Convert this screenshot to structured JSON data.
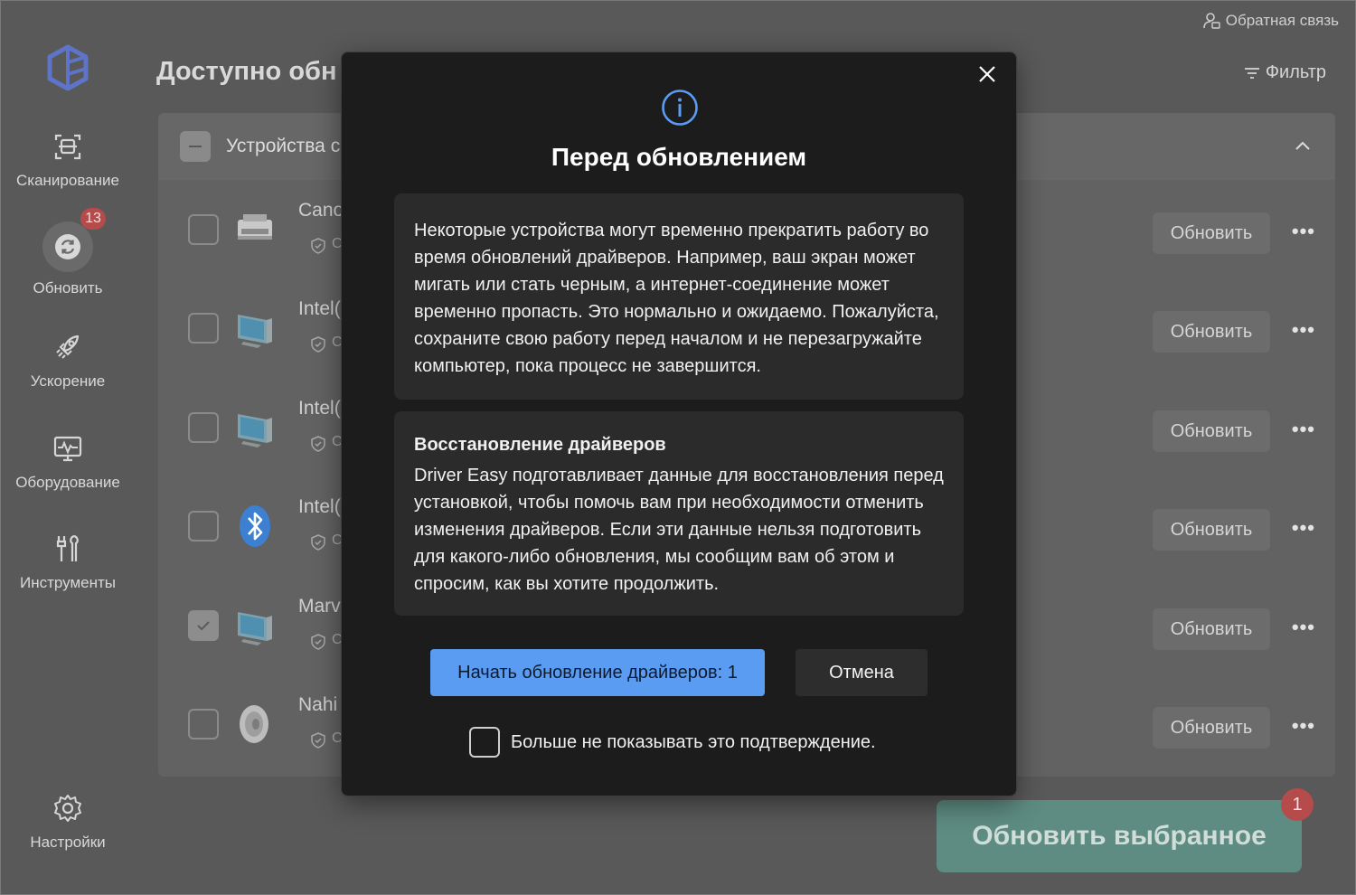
{
  "header": {
    "feedback_label": "Обратная связь",
    "filter_label": "Фильтр",
    "page_title": "Доступно обн"
  },
  "sidebar": {
    "items": [
      {
        "label": "Сканирование",
        "icon": "scan-icon"
      },
      {
        "label": "Обновить",
        "icon": "update-icon",
        "badge": "13"
      },
      {
        "label": "Ускорение",
        "icon": "rocket-icon"
      },
      {
        "label": "Оборудование",
        "icon": "hardware-monitor-icon"
      },
      {
        "label": "Инструменты",
        "icon": "tools-icon"
      },
      {
        "label": "Настройки",
        "icon": "gear-icon"
      }
    ]
  },
  "device_group": {
    "label": "Устройства с"
  },
  "devices": [
    {
      "name": "Cano",
      "sub": "С",
      "icon": "printer-icon",
      "checked": false,
      "action": "Обновить"
    },
    {
      "name": "Intel(",
      "sub": "С",
      "icon": "monitor-icon",
      "checked": false,
      "action": "Обновить"
    },
    {
      "name": "Intel(",
      "sub": "С",
      "icon": "monitor-icon",
      "checked": false,
      "action": "Обновить"
    },
    {
      "name": "Intel(",
      "sub": "С",
      "icon": "bluetooth-icon",
      "checked": false,
      "action": "Обновить"
    },
    {
      "name": "Marv",
      "sub": "С",
      "icon": "monitor-icon",
      "checked": true,
      "action": "Обновить"
    },
    {
      "name": "Nahi",
      "sub": "С",
      "icon": "speaker-icon",
      "checked": false,
      "action": "Обновить"
    }
  ],
  "more_label": "•••",
  "bottom": {
    "update_selected_label": "Обновить выбранное",
    "selected_badge": "1"
  },
  "modal": {
    "title": "Перед обновлением",
    "warning_text": "Некоторые устройства могут временно прекратить работу во время обновлений драйверов. Например, ваш экран может мигать или стать черным, а интернет-соединение может временно пропасть. Это нормально и ожидаемо. Пожалуйста, сохраните свою работу перед началом и не перезагружайте компьютер, пока процесс не завершится.",
    "restore_heading": "Восстановление драйверов",
    "restore_text": "Driver Easy подготавливает данные для восстановления перед установкой, чтобы помочь вам при необходимости отменить изменения драйверов. Если эти данные нельзя подготовить для какого-либо обновления, мы сообщим вам об этом и спросим, как вы хотите продолжить.",
    "start_button": "Начать обновление драйверов: 1",
    "cancel_button": "Отмена",
    "dont_show_label": "Больше не показывать это подтверждение."
  },
  "colors": {
    "accent_blue": "#5b9cf3",
    "badge_red": "#b54b4b",
    "update_green": "#5e8c82",
    "modal_bg": "#1c1c1c"
  }
}
